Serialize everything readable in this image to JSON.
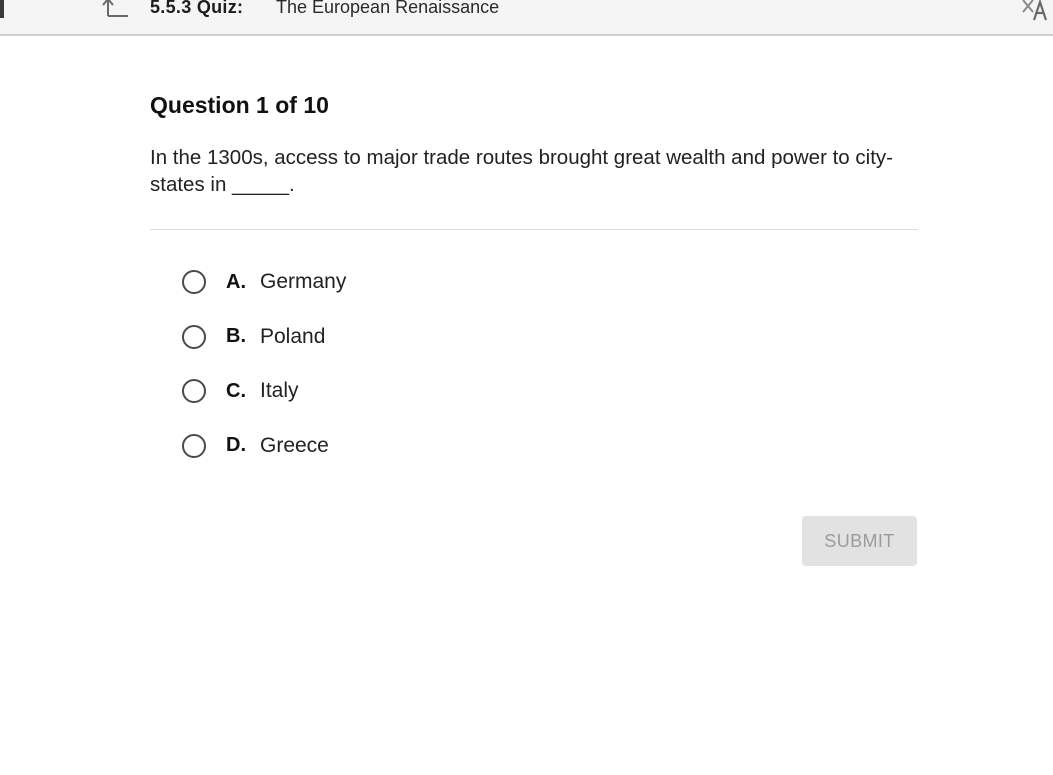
{
  "header": {
    "quiz_code": "5.5.3  Quiz:",
    "quiz_title": "The European Renaissance",
    "icons": [
      "back-arrow-icon",
      "translate-icon"
    ]
  },
  "question": {
    "number_label": "Question 1 of 10",
    "text": "In the 1300s, access to major trade routes brought great wealth and power to city-states in _____."
  },
  "options": [
    {
      "letter": "A.",
      "text": "Germany",
      "selected": false
    },
    {
      "letter": "B.",
      "text": "Poland",
      "selected": false
    },
    {
      "letter": "C.",
      "text": "Italy",
      "selected": false
    },
    {
      "letter": "D.",
      "text": "Greece",
      "selected": false
    }
  ],
  "submit": {
    "label": "SUBMIT",
    "enabled": false
  },
  "colors": {
    "submit_bg": "#e2e2e2",
    "submit_text": "#9b9b9b",
    "divider": "#dcdcdc"
  }
}
